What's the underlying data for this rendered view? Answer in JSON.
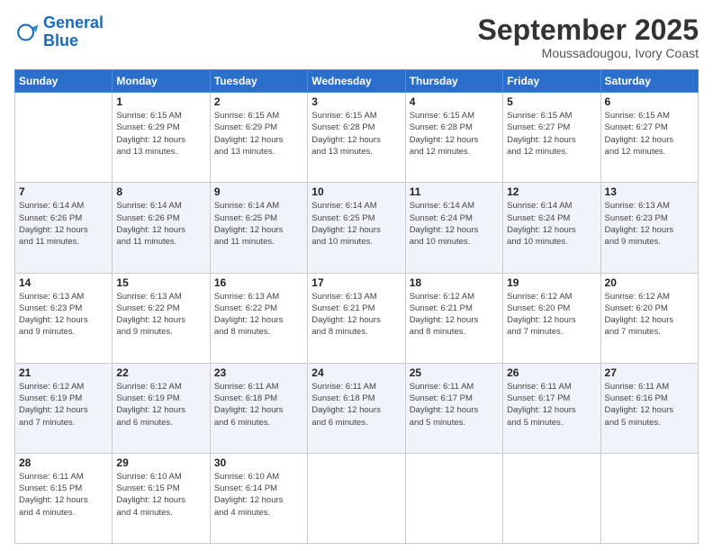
{
  "logo": {
    "text_general": "General",
    "text_blue": "Blue"
  },
  "header": {
    "month": "September 2025",
    "location": "Moussadougou, Ivory Coast"
  },
  "days_of_week": [
    "Sunday",
    "Monday",
    "Tuesday",
    "Wednesday",
    "Thursday",
    "Friday",
    "Saturday"
  ],
  "weeks": [
    [
      {
        "day": "",
        "info": ""
      },
      {
        "day": "1",
        "info": "Sunrise: 6:15 AM\nSunset: 6:29 PM\nDaylight: 12 hours\nand 13 minutes."
      },
      {
        "day": "2",
        "info": "Sunrise: 6:15 AM\nSunset: 6:29 PM\nDaylight: 12 hours\nand 13 minutes."
      },
      {
        "day": "3",
        "info": "Sunrise: 6:15 AM\nSunset: 6:28 PM\nDaylight: 12 hours\nand 13 minutes."
      },
      {
        "day": "4",
        "info": "Sunrise: 6:15 AM\nSunset: 6:28 PM\nDaylight: 12 hours\nand 12 minutes."
      },
      {
        "day": "5",
        "info": "Sunrise: 6:15 AM\nSunset: 6:27 PM\nDaylight: 12 hours\nand 12 minutes."
      },
      {
        "day": "6",
        "info": "Sunrise: 6:15 AM\nSunset: 6:27 PM\nDaylight: 12 hours\nand 12 minutes."
      }
    ],
    [
      {
        "day": "7",
        "info": "Sunrise: 6:14 AM\nSunset: 6:26 PM\nDaylight: 12 hours\nand 11 minutes."
      },
      {
        "day": "8",
        "info": "Sunrise: 6:14 AM\nSunset: 6:26 PM\nDaylight: 12 hours\nand 11 minutes."
      },
      {
        "day": "9",
        "info": "Sunrise: 6:14 AM\nSunset: 6:25 PM\nDaylight: 12 hours\nand 11 minutes."
      },
      {
        "day": "10",
        "info": "Sunrise: 6:14 AM\nSunset: 6:25 PM\nDaylight: 12 hours\nand 10 minutes."
      },
      {
        "day": "11",
        "info": "Sunrise: 6:14 AM\nSunset: 6:24 PM\nDaylight: 12 hours\nand 10 minutes."
      },
      {
        "day": "12",
        "info": "Sunrise: 6:14 AM\nSunset: 6:24 PM\nDaylight: 12 hours\nand 10 minutes."
      },
      {
        "day": "13",
        "info": "Sunrise: 6:13 AM\nSunset: 6:23 PM\nDaylight: 12 hours\nand 9 minutes."
      }
    ],
    [
      {
        "day": "14",
        "info": "Sunrise: 6:13 AM\nSunset: 6:23 PM\nDaylight: 12 hours\nand 9 minutes."
      },
      {
        "day": "15",
        "info": "Sunrise: 6:13 AM\nSunset: 6:22 PM\nDaylight: 12 hours\nand 9 minutes."
      },
      {
        "day": "16",
        "info": "Sunrise: 6:13 AM\nSunset: 6:22 PM\nDaylight: 12 hours\nand 8 minutes."
      },
      {
        "day": "17",
        "info": "Sunrise: 6:13 AM\nSunset: 6:21 PM\nDaylight: 12 hours\nand 8 minutes."
      },
      {
        "day": "18",
        "info": "Sunrise: 6:12 AM\nSunset: 6:21 PM\nDaylight: 12 hours\nand 8 minutes."
      },
      {
        "day": "19",
        "info": "Sunrise: 6:12 AM\nSunset: 6:20 PM\nDaylight: 12 hours\nand 7 minutes."
      },
      {
        "day": "20",
        "info": "Sunrise: 6:12 AM\nSunset: 6:20 PM\nDaylight: 12 hours\nand 7 minutes."
      }
    ],
    [
      {
        "day": "21",
        "info": "Sunrise: 6:12 AM\nSunset: 6:19 PM\nDaylight: 12 hours\nand 7 minutes."
      },
      {
        "day": "22",
        "info": "Sunrise: 6:12 AM\nSunset: 6:19 PM\nDaylight: 12 hours\nand 6 minutes."
      },
      {
        "day": "23",
        "info": "Sunrise: 6:11 AM\nSunset: 6:18 PM\nDaylight: 12 hours\nand 6 minutes."
      },
      {
        "day": "24",
        "info": "Sunrise: 6:11 AM\nSunset: 6:18 PM\nDaylight: 12 hours\nand 6 minutes."
      },
      {
        "day": "25",
        "info": "Sunrise: 6:11 AM\nSunset: 6:17 PM\nDaylight: 12 hours\nand 5 minutes."
      },
      {
        "day": "26",
        "info": "Sunrise: 6:11 AM\nSunset: 6:17 PM\nDaylight: 12 hours\nand 5 minutes."
      },
      {
        "day": "27",
        "info": "Sunrise: 6:11 AM\nSunset: 6:16 PM\nDaylight: 12 hours\nand 5 minutes."
      }
    ],
    [
      {
        "day": "28",
        "info": "Sunrise: 6:11 AM\nSunset: 6:15 PM\nDaylight: 12 hours\nand 4 minutes."
      },
      {
        "day": "29",
        "info": "Sunrise: 6:10 AM\nSunset: 6:15 PM\nDaylight: 12 hours\nand 4 minutes."
      },
      {
        "day": "30",
        "info": "Sunrise: 6:10 AM\nSunset: 6:14 PM\nDaylight: 12 hours\nand 4 minutes."
      },
      {
        "day": "",
        "info": ""
      },
      {
        "day": "",
        "info": ""
      },
      {
        "day": "",
        "info": ""
      },
      {
        "day": "",
        "info": ""
      }
    ]
  ]
}
